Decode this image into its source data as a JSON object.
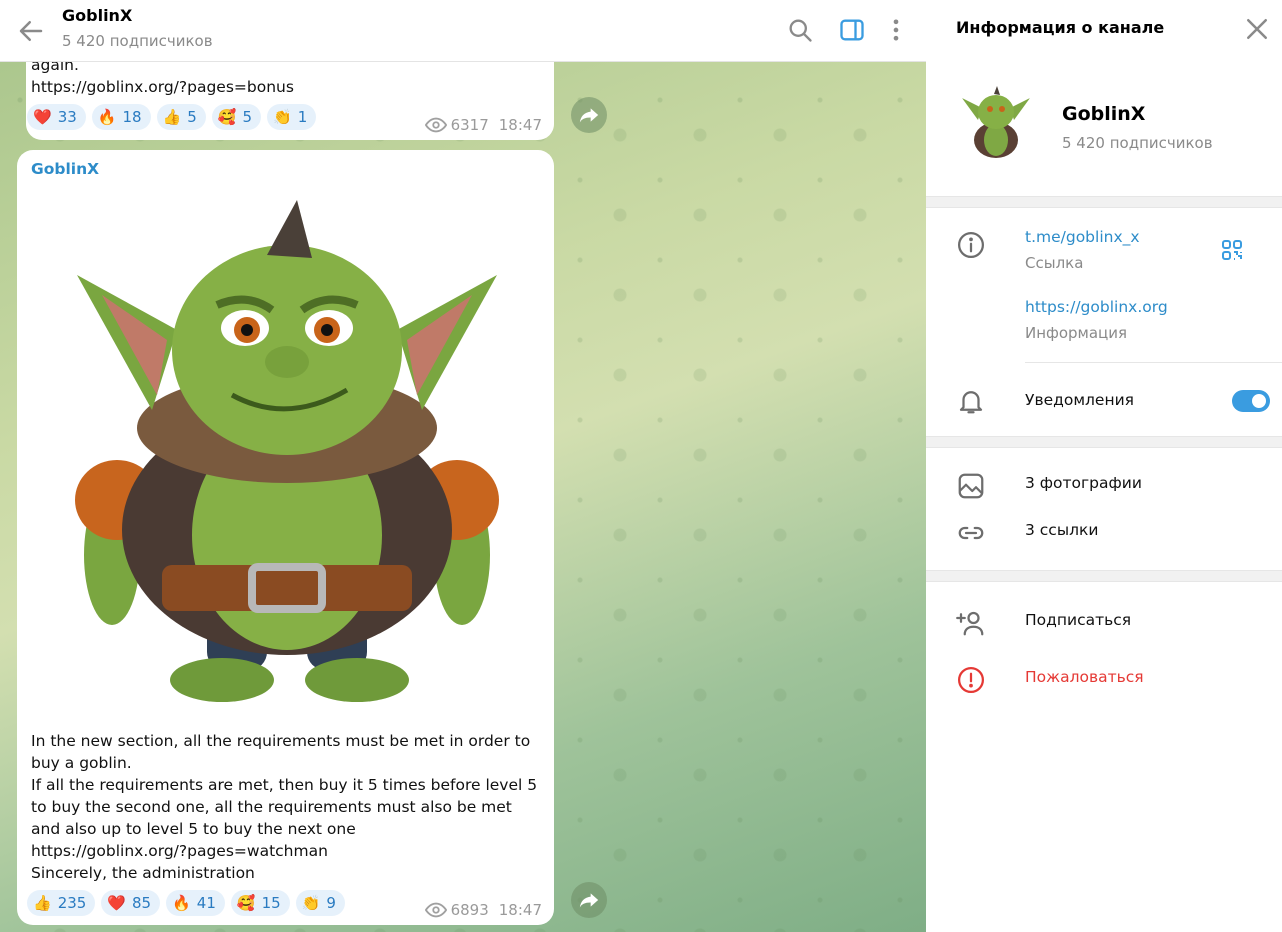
{
  "header": {
    "channel_name": "GoblinX",
    "subscribers": "5 420 подписчиков"
  },
  "messages": [
    {
      "text_tail": "again.",
      "link": "https://goblinx.org/?pages=bonus",
      "reactions": [
        {
          "emoji": "❤️",
          "count": "33"
        },
        {
          "emoji": "🔥",
          "count": "18"
        },
        {
          "emoji": "👍",
          "count": "5"
        },
        {
          "emoji": "🥰",
          "count": "5"
        },
        {
          "emoji": "👏",
          "count": "1"
        }
      ],
      "views": "6317",
      "time": "18:47"
    },
    {
      "sender": "GoblinX",
      "text_1": "In the new section, all the requirements must be met in order to buy a goblin.",
      "text_2": "If all the requirements are met, then buy it 5 times before level 5 to buy the second one, all the requirements must also be met and also up to level 5 to buy the next one",
      "link": "https://goblinx.org/?pages=watchman",
      "text_3": "Sincerely, the administration",
      "reactions": [
        {
          "emoji": "👍",
          "count": "235"
        },
        {
          "emoji": "❤️",
          "count": "85"
        },
        {
          "emoji": "🔥",
          "count": "41"
        },
        {
          "emoji": "🥰",
          "count": "15"
        },
        {
          "emoji": "👏",
          "count": "9"
        }
      ],
      "views": "6893",
      "time": "18:47"
    }
  ],
  "info_panel": {
    "title": "Информация о канале",
    "name": "GoblinX",
    "subscribers": "5 420 подписчиков",
    "link_value": "t.me/goblinx_x",
    "link_label": "Ссылка",
    "info_value": "https://goblinx.org",
    "info_label": "Информация",
    "notifications_label": "Уведомления",
    "notifications_on": true,
    "photos_label": "3 фотографии",
    "links_label": "3 ссылки",
    "subscribe_label": "Подписаться",
    "report_label": "Пожаловаться"
  },
  "colors": {
    "accent": "#2d8cc9",
    "report": "#e53935",
    "reaction_bg": "#e6f1fb"
  }
}
